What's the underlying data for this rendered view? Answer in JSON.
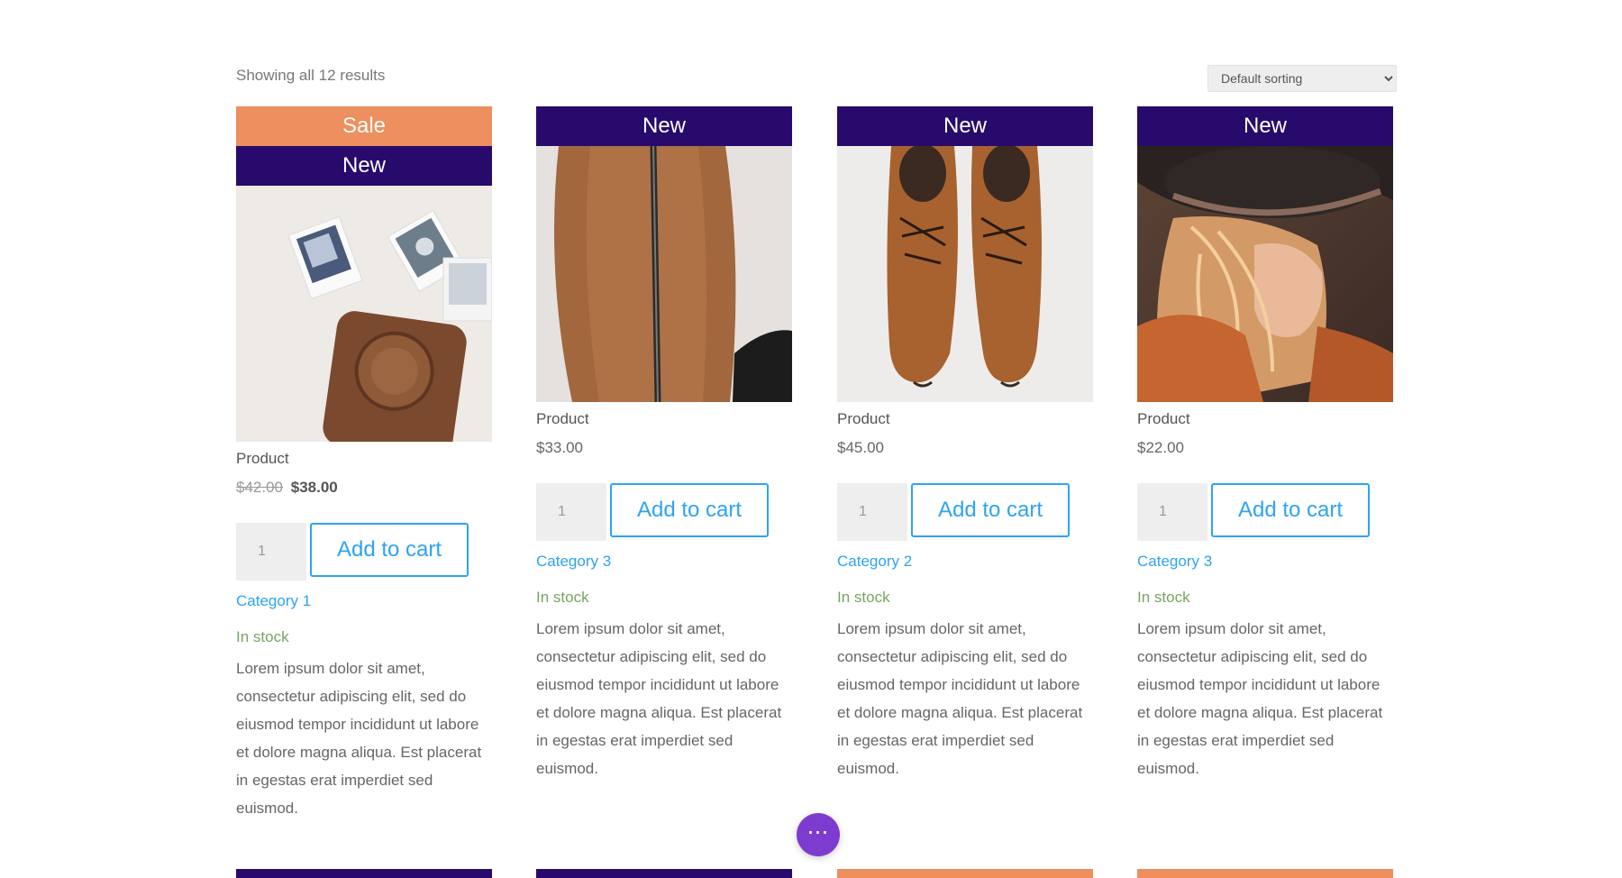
{
  "toolbar": {
    "result_count": "Showing all 12 results",
    "sort_selected": "Default sorting"
  },
  "products": [
    {
      "badges": [
        "Sale",
        "New"
      ],
      "title": "Product",
      "price_old": "$42.00",
      "price": "$38.00",
      "qty": "1",
      "button": "Add to cart",
      "category": "Category 1",
      "stock": "In stock",
      "description": "Lorem ipsum dolor sit amet, consectetur adipiscing elit, sed do eiusmod tempor incididunt ut labore et dolore magna aliqua. Est placerat in egestas erat imperdiet sed euismod."
    },
    {
      "badges": [
        "New"
      ],
      "title": "Product",
      "price": "$33.00",
      "qty": "1",
      "button": "Add to cart",
      "category": "Category 3",
      "stock": "In stock",
      "description": "Lorem ipsum dolor sit amet, consectetur adipiscing elit, sed do eiusmod tempor incididunt ut labore et dolore magna aliqua. Est placerat in egestas erat imperdiet sed euismod."
    },
    {
      "badges": [
        "New"
      ],
      "title": "Product",
      "price": "$45.00",
      "qty": "1",
      "button": "Add to cart",
      "category": "Category 2",
      "stock": "In stock",
      "description": "Lorem ipsum dolor sit amet, consectetur adipiscing elit, sed do eiusmod tempor incididunt ut labore et dolore magna aliqua. Est placerat in egestas erat imperdiet sed euismod."
    },
    {
      "badges": [
        "New"
      ],
      "title": "Product",
      "price": "$22.00",
      "qty": "1",
      "button": "Add to cart",
      "category": "Category 3",
      "stock": "In stock",
      "description": "Lorem ipsum dolor sit amet, consectetur adipiscing elit, sed do eiusmod tempor incididunt ut labore et dolore magna aliqua. Est placerat in egestas erat imperdiet sed euismod."
    }
  ],
  "fab": {
    "icon": "more-dots-icon",
    "glyph": "⋯"
  },
  "colors": {
    "sale_badge": "#ed8f5e",
    "new_badge": "#280a6c",
    "accent": "#2ea3f2",
    "in_stock": "#77a464",
    "fab": "#7e3bd0"
  }
}
